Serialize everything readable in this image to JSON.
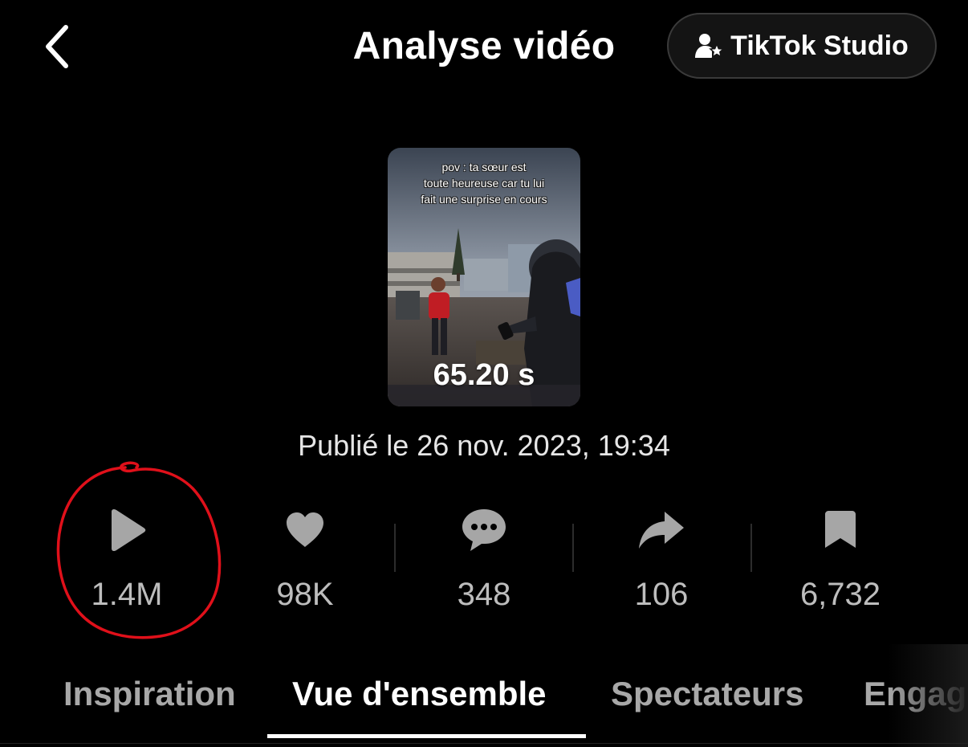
{
  "header": {
    "title": "Analyse vidéo",
    "studio_label": "TikTok Studio"
  },
  "video": {
    "caption_line1": "pov : ta sœur est",
    "caption_line2": "toute heureuse car tu lui",
    "caption_line3": "fait une surprise en cours",
    "duration": "65.20 s",
    "published": "Publié le 26 nov. 2023, 19:34"
  },
  "stats": {
    "views": "1.4M",
    "likes": "98K",
    "comments": "348",
    "shares": "106",
    "saves": "6,732"
  },
  "tabs": [
    {
      "label": "Inspiration",
      "active": false
    },
    {
      "label": "Vue d'ensemble",
      "active": true
    },
    {
      "label": "Spectateurs",
      "active": false
    },
    {
      "label": "Engag",
      "active": false
    }
  ],
  "colors": {
    "background": "#000000",
    "icon_gray": "#a6a6a6",
    "annotation_red": "#e0101a"
  }
}
